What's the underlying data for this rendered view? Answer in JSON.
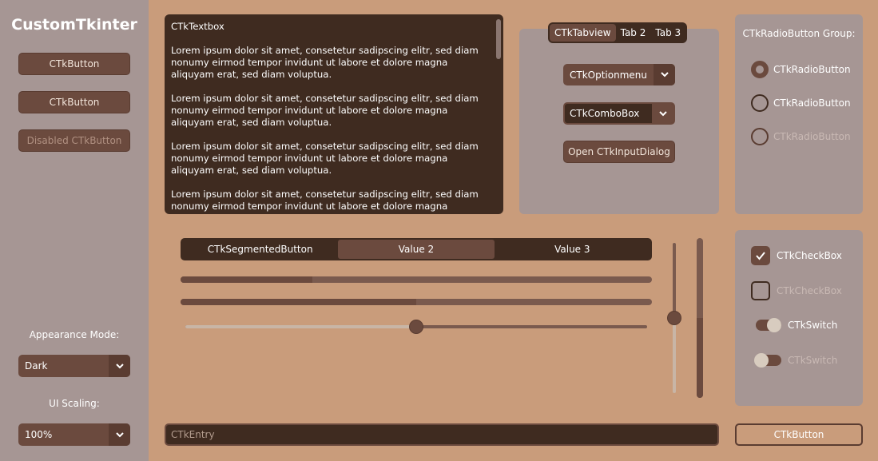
{
  "sidebar": {
    "logo": "CustomTkinter",
    "button1": "CTkButton",
    "button2": "CTkButton",
    "button3_disabled": "Disabled CTkButton",
    "appearance_label": "Appearance Mode:",
    "appearance_value": "Dark",
    "scaling_label": "UI Scaling:",
    "scaling_value": "100%"
  },
  "textbox": {
    "title": "CTkTextbox",
    "paragraph": "Lorem ipsum dolor sit amet, consetetur sadipscing elitr, sed diam nonumy eirmod tempor invidunt ut labore et dolore magna aliquyam erat, sed diam voluptua.",
    "paragraph_count": 4
  },
  "tabview": {
    "tabs": [
      "CTkTabview",
      "Tab 2",
      "Tab 3"
    ],
    "active_tab": 0,
    "optionmenu_value": "CTkOptionmenu",
    "combobox_value": "CTkComboBox",
    "input_dialog_button": "Open CTkInputDialog"
  },
  "radio_group": {
    "title": "CTkRadioButton Group:",
    "items": [
      {
        "label": "CTkRadioButton",
        "checked": true,
        "disabled": false
      },
      {
        "label": "CTkRadioButton",
        "checked": false,
        "disabled": false
      },
      {
        "label": "CTkRadioButton",
        "checked": false,
        "disabled": true
      }
    ]
  },
  "segmented": {
    "values": [
      "CTkSegmentedButton",
      "Value 2",
      "Value 3"
    ],
    "selected": 1
  },
  "progress": {
    "bar1": 0.28,
    "bar2": 0.5,
    "slider": 0.5,
    "vslider": 0.5,
    "vprogress": 0.5
  },
  "checks": {
    "checkbox1": {
      "label": "CTkCheckBox",
      "checked": true,
      "disabled": false
    },
    "checkbox2": {
      "label": "CTkCheckBox",
      "checked": false,
      "disabled": true
    },
    "switch1": {
      "label": "CTkSwitch",
      "on": false,
      "disabled": false
    },
    "switch2": {
      "label": "CTkSwitch",
      "on": false,
      "disabled": true
    }
  },
  "entry": {
    "placeholder": "CTkEntry"
  },
  "bottom_button": "CTkButton",
  "icons": {
    "dropdown": "chevron-down-icon",
    "checkmark": "checkmark-icon"
  },
  "colors": {
    "accent": "#6b4a3e",
    "dark": "#3f2b20",
    "background": "#c99c7b",
    "panel": "#a69694"
  }
}
